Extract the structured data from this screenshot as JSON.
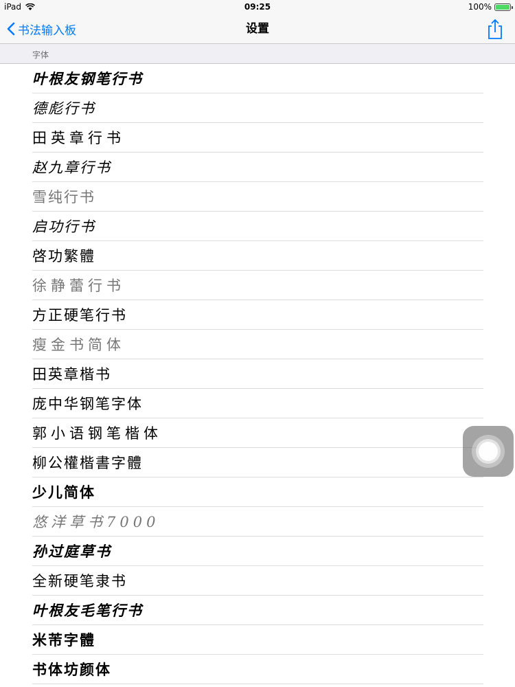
{
  "status": {
    "device": "iPad",
    "time": "09:25",
    "battery": "100%"
  },
  "nav": {
    "back_label": "书法输入板",
    "title": "设置"
  },
  "section": {
    "header": "字体"
  },
  "fonts": [
    "叶根友钢笔行书",
    "德彪行书",
    "田英章行书",
    "赵九章行书",
    "雪纯行书",
    "启功行书",
    "啓功繁體",
    "徐静蕾行书",
    "方正硬笔行书",
    "瘦金书简体",
    "田英章楷书",
    "庞中华钢笔字体",
    "郭小语钢笔楷体",
    "柳公權楷書字體",
    "少儿简体",
    "悠洋草书7000",
    "孙过庭草书",
    "全新硬笔隶书",
    "叶根友毛笔行书",
    "米芾字體",
    "书体坊颜体"
  ]
}
